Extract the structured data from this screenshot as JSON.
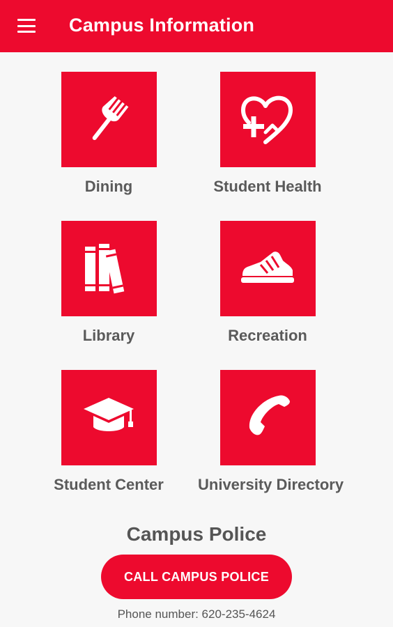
{
  "appbar": {
    "title": "Campus Information",
    "menu_icon": "hamburger-menu-icon",
    "background": "#ed0a2e"
  },
  "tiles": [
    {
      "label": "Dining",
      "icon": "fork-icon"
    },
    {
      "label": "Student Health",
      "icon": "heart-plus-icon"
    },
    {
      "label": "Library",
      "icon": "books-icon"
    },
    {
      "label": "Recreation",
      "icon": "sneaker-icon"
    },
    {
      "label": "Student Center",
      "icon": "graduation-cap-icon"
    },
    {
      "label": "University Directory",
      "icon": "phone-icon"
    }
  ],
  "police": {
    "title": "Campus Police",
    "button_label": "CALL CAMPUS POLICE",
    "phone_text": "Phone number: 620-235-4624"
  },
  "colors": {
    "accent": "#ed0a2e",
    "text": "#5a5a5a",
    "background": "#f7f7f7"
  }
}
